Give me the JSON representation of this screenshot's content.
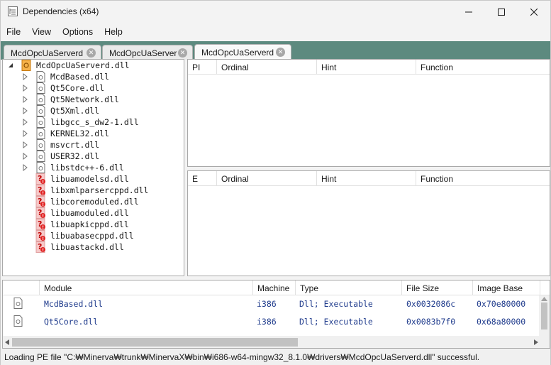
{
  "window": {
    "title": "Dependencies (x64)"
  },
  "menu": {
    "items": [
      {
        "label": "File"
      },
      {
        "label": "View"
      },
      {
        "label": "Options"
      },
      {
        "label": "Help"
      }
    ]
  },
  "tabs": [
    {
      "label": "McdOpcUaServerd",
      "active": false
    },
    {
      "label": "McdOpcUaServer",
      "active": false
    },
    {
      "label": "McdOpcUaServerd",
      "active": true
    }
  ],
  "tree": {
    "root": {
      "label": "McdOpcUaServerd.dll",
      "icon": "root-module-icon"
    },
    "children": [
      {
        "label": "McdBased.dll",
        "status": "found"
      },
      {
        "label": "Qt5Core.dll",
        "status": "found"
      },
      {
        "label": "Qt5Network.dll",
        "status": "found"
      },
      {
        "label": "Qt5Xml.dll",
        "status": "found"
      },
      {
        "label": "libgcc_s_dw2-1.dll",
        "status": "found"
      },
      {
        "label": "KERNEL32.dll",
        "status": "found"
      },
      {
        "label": "msvcrt.dll",
        "status": "found"
      },
      {
        "label": "USER32.dll",
        "status": "found"
      },
      {
        "label": "libstdc++-6.dll",
        "status": "found"
      },
      {
        "label": "libuamodelsd.dll",
        "status": "missing"
      },
      {
        "label": "libxmlparsercppd.dll",
        "status": "missing"
      },
      {
        "label": "libcoremoduled.dll",
        "status": "missing"
      },
      {
        "label": "libuamoduled.dll",
        "status": "missing"
      },
      {
        "label": "libuapkicppd.dll",
        "status": "missing"
      },
      {
        "label": "libuabasecppd.dll",
        "status": "missing"
      },
      {
        "label": "libuastackd.dll",
        "status": "missing"
      }
    ]
  },
  "imports": {
    "headers": [
      "PI",
      "Ordinal",
      "Hint",
      "Function"
    ]
  },
  "exports": {
    "headers": [
      "E",
      "Ordinal",
      "Hint",
      "Function"
    ]
  },
  "modules": {
    "headers": [
      "Module",
      "Machine",
      "Type",
      "File Size",
      "Image Base"
    ],
    "rows": [
      {
        "module": "McdBased.dll",
        "machine": "i386",
        "type": "Dll; Executable",
        "file_size": "0x0032086c",
        "image_base": "0x70e80000"
      },
      {
        "module": "Qt5Core.dll",
        "machine": "i386",
        "type": "Dll; Executable",
        "file_size": "0x0083b7f0",
        "image_base": "0x68a80000"
      }
    ]
  },
  "status": {
    "text": "Loading PE file \"C:₩Minerva₩trunk₩MinervaX₩bin₩i686-w64-mingw32_8.1.0₩drivers₩McdOpcUaServerd.dll\" successful."
  },
  "colors": {
    "tab_strip": "#5d8a7f",
    "module_text": "#1f3b8c",
    "missing_icon": "#e02020"
  }
}
